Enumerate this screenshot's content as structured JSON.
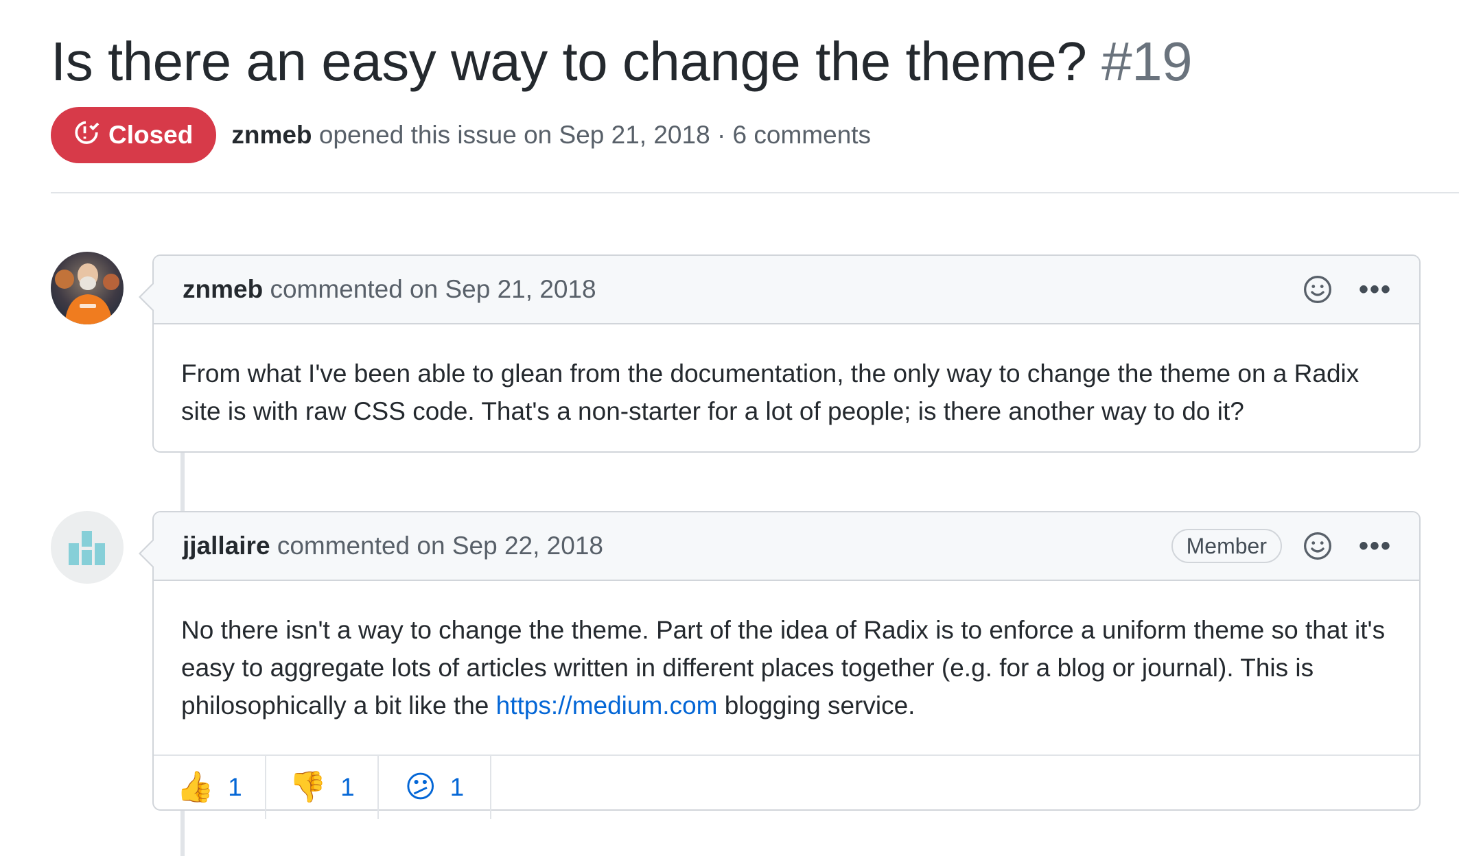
{
  "issue": {
    "title": "Is there an easy way to change the theme?",
    "number": "#19",
    "state": "Closed",
    "author": "znmeb",
    "opened_text": "opened this issue on Sep 21, 2018 · 6 comments"
  },
  "comments": [
    {
      "author": "znmeb",
      "action": "commented on Sep 21, 2018",
      "body": "From what I've been able to glean from the documentation, the only way to change the theme on a Radix site is with raw CSS code. That's a non-starter for a lot of people; is there another way to do it?"
    },
    {
      "author": "jjallaire",
      "action": "commented on Sep 22, 2018",
      "badge": "Member",
      "body_part1": "No there isn't a way to change the theme. Part of the idea of Radix is to enforce a uniform theme so that it's easy to aggregate lots of articles written in different places together (e.g. for a blog or journal). This is philosophically a bit like the ",
      "link_text": "https://medium.com",
      "body_part2": " blogging service.",
      "reactions": [
        {
          "emoji": "👍",
          "icon": "thumbs-up-icon",
          "count": "1"
        },
        {
          "emoji": "👎",
          "icon": "thumbs-down-icon",
          "count": "1"
        },
        {
          "emoji": "😕",
          "icon": "confused-face-icon",
          "count": "1"
        }
      ]
    }
  ],
  "colors": {
    "closed": "#d73a49",
    "link": "#0366d6",
    "muted": "#586069",
    "header_bg": "#f6f8fa",
    "border": "#d1d5da"
  },
  "icons": {
    "state": "issue-closed-icon",
    "add_reaction": "smiley-icon",
    "more": "kebab-horizontal-icon"
  },
  "more_glyph": "•••"
}
